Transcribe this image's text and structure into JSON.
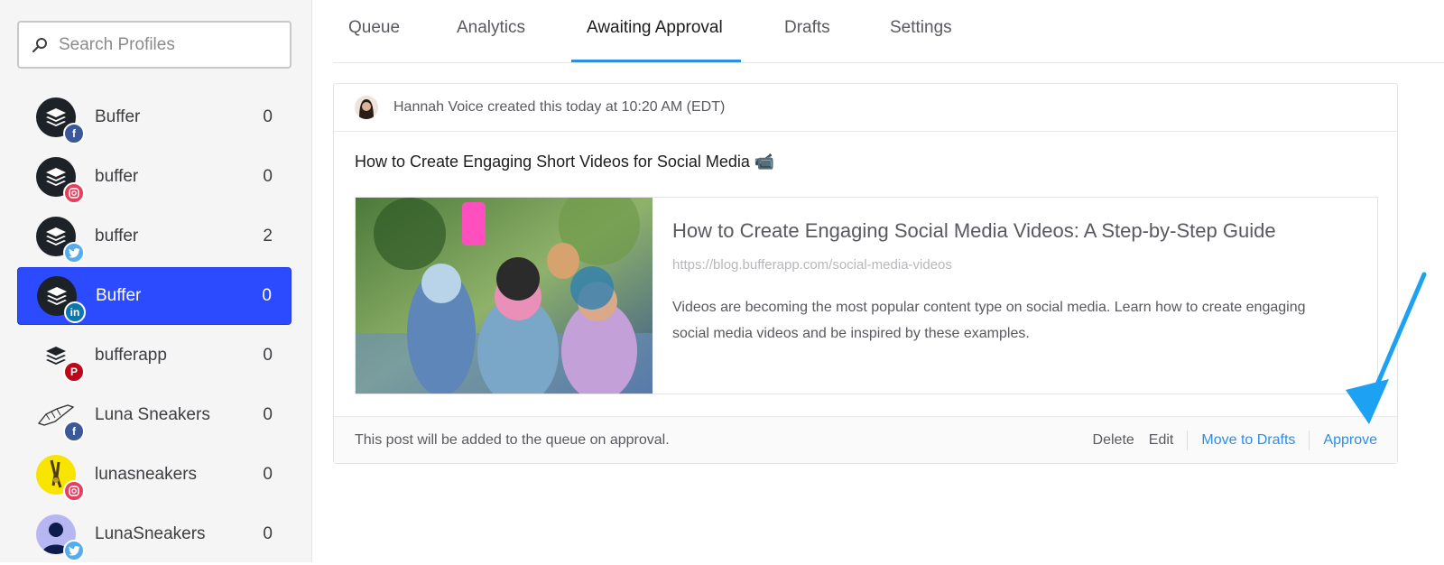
{
  "sidebar": {
    "search_placeholder": "Search Profiles",
    "profiles": [
      {
        "name": "Buffer",
        "count": "0",
        "network": "facebook",
        "avatar": "buffer-logo"
      },
      {
        "name": "buffer",
        "count": "0",
        "network": "instagram",
        "avatar": "buffer-logo"
      },
      {
        "name": "buffer",
        "count": "2",
        "network": "twitter",
        "avatar": "buffer-logo"
      },
      {
        "name": "Buffer",
        "count": "0",
        "network": "linkedin",
        "avatar": "buffer-logo",
        "active": true
      },
      {
        "name": "bufferapp",
        "count": "0",
        "network": "pinterest",
        "avatar": "buffer-logo"
      },
      {
        "name": "Luna Sneakers",
        "count": "0",
        "network": "facebook",
        "avatar": "sneaker-sketch"
      },
      {
        "name": "lunasneakers",
        "count": "0",
        "network": "instagram",
        "avatar": "yellow-sneaker"
      },
      {
        "name": "LunaSneakers",
        "count": "0",
        "network": "twitter",
        "avatar": "person-silhouette"
      }
    ]
  },
  "tabs": {
    "queue": "Queue",
    "analytics": "Analytics",
    "awaiting_approval": "Awaiting Approval",
    "drafts": "Drafts",
    "settings": "Settings",
    "active": "awaiting_approval"
  },
  "post": {
    "author_line": "Hannah Voice created this today at 10:20 AM (EDT)",
    "text": "How to Create Engaging Short Videos for Social Media 📹",
    "link": {
      "title": "How to Create Engaging Social Media Videos: A Step-by-Step Guide",
      "url": "https://blog.bufferapp.com/social-media-videos",
      "description": "Videos are becoming the most popular content type on social media. Learn how to create engaging social media videos and be inspired by these examples."
    },
    "footer_message": "This post will be added to the queue on approval.",
    "actions": {
      "delete": "Delete",
      "edit": "Edit",
      "move_to_drafts": "Move to Drafts",
      "approve": "Approve"
    }
  },
  "colors": {
    "accent": "#2c8ee6",
    "active_profile": "#2c4bff",
    "arrow": "#1da1f2"
  }
}
